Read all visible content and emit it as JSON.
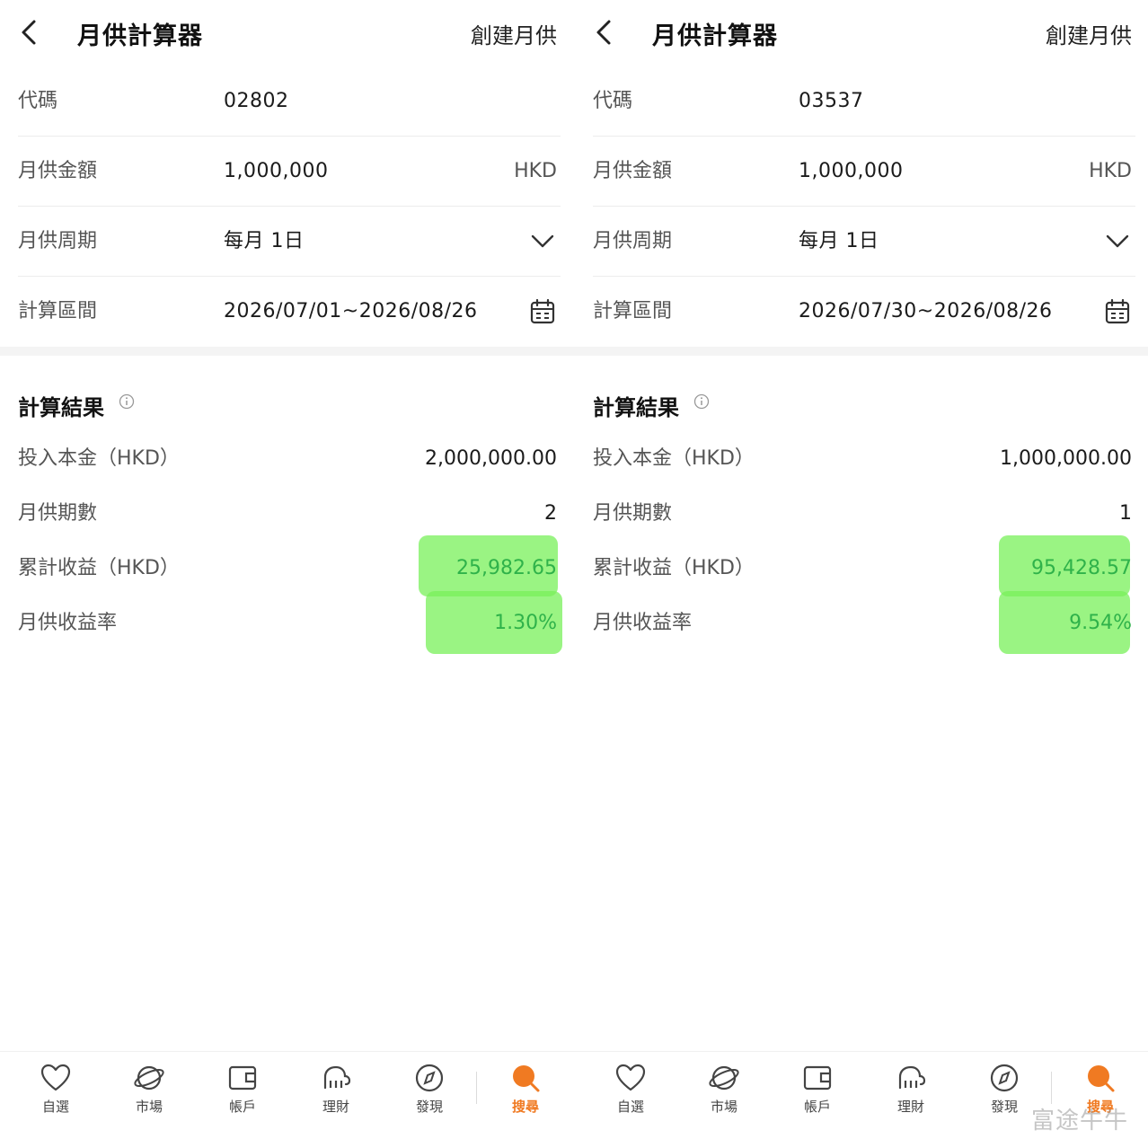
{
  "left": {
    "header": {
      "title": "月供計算器",
      "create_label": "創建月供"
    },
    "form": {
      "code_label": "代碼",
      "code_value": "02802",
      "amount_label": "月供金額",
      "amount_value": "1,000,000",
      "amount_unit": "HKD",
      "cycle_label": "月供周期",
      "cycle_value": "每月 1日",
      "range_label": "計算區間",
      "range_value": "2026/07/01~2026/08/26"
    },
    "results": {
      "title": "計算結果",
      "principal_label": "投入本金（HKD）",
      "principal_value": "2,000,000.00",
      "periods_label": "月供期數",
      "periods_value": "2",
      "profit_label": "累計收益（HKD）",
      "profit_value": "25,982.65",
      "rate_label": "月供收益率",
      "rate_value": "1.30%"
    }
  },
  "right": {
    "header": {
      "title": "月供計算器",
      "create_label": "創建月供"
    },
    "form": {
      "code_label": "代碼",
      "code_value": "03537",
      "amount_label": "月供金額",
      "amount_value": "1,000,000",
      "amount_unit": "HKD",
      "cycle_label": "月供周期",
      "cycle_value": "每月 1日",
      "range_label": "計算區間",
      "range_value": "2026/07/30~2026/08/26"
    },
    "results": {
      "title": "計算結果",
      "principal_label": "投入本金（HKD）",
      "principal_value": "1,000,000.00",
      "periods_label": "月供期數",
      "periods_value": "1",
      "profit_label": "累計收益（HKD）",
      "profit_value": "95,428.57",
      "rate_label": "月供收益率",
      "rate_value": "9.54%"
    }
  },
  "tabbar": {
    "items": [
      {
        "label": "自選",
        "icon": "heart-icon"
      },
      {
        "label": "市場",
        "icon": "planet-icon"
      },
      {
        "label": "帳戶",
        "icon": "wallet-icon"
      },
      {
        "label": "理財",
        "icon": "elephant-icon"
      },
      {
        "label": "發現",
        "icon": "compass-icon"
      },
      {
        "label": "搜尋",
        "icon": "search-icon"
      }
    ]
  },
  "watermark": "富途牛牛",
  "colors": {
    "accent": "#f07a22",
    "profit_green": "#2fb24a",
    "highlight": "#78f05a"
  }
}
